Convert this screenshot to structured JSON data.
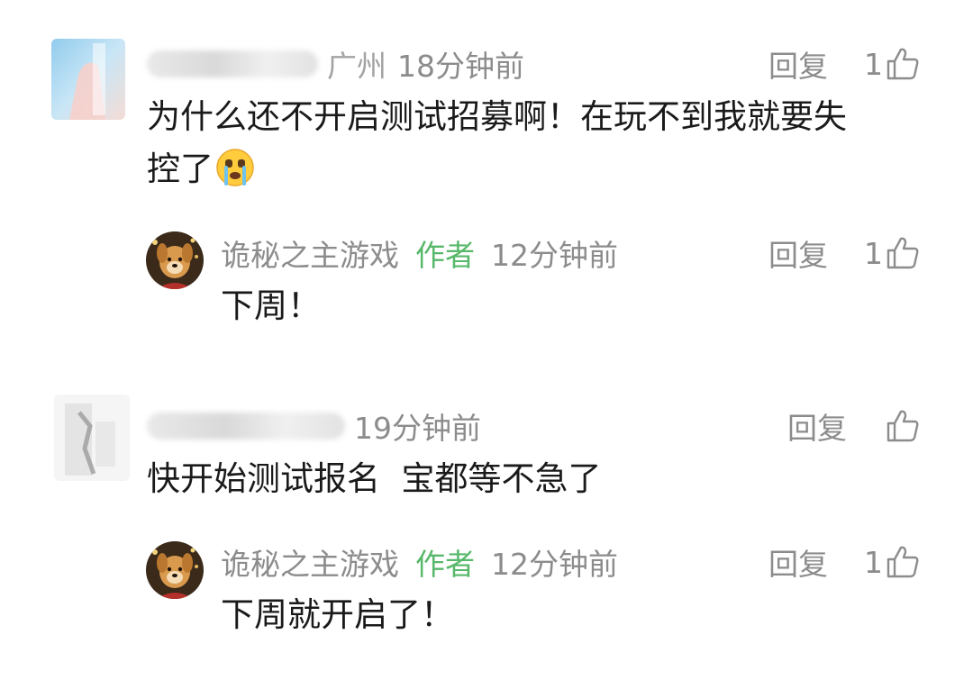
{
  "comments": [
    {
      "location": "广州",
      "time": "18分钟前",
      "text": "为什么还不开启测试招募啊！在玩不到我就要失",
      "text_line2": "控了",
      "emoji": "crying-face-icon",
      "reply_label": "回复",
      "likes": "1",
      "reply": {
        "name": "诡秘之主游戏",
        "author_tag": "作者",
        "time": "12分钟前",
        "text": "下周！",
        "reply_label": "回复",
        "likes": "1"
      }
    },
    {
      "time": "19分钟前",
      "text": "快开始测试报名  宝都等不急了",
      "reply_label": "回复",
      "likes": "",
      "reply": {
        "name": "诡秘之主游戏",
        "author_tag": "作者",
        "time": "12分钟前",
        "text": "下周就开启了！",
        "reply_label": "回复",
        "likes": "1"
      }
    }
  ],
  "colors": {
    "author_tag": "#57b86a",
    "meta": "#8c8c8c",
    "text": "#1a1a1a"
  }
}
